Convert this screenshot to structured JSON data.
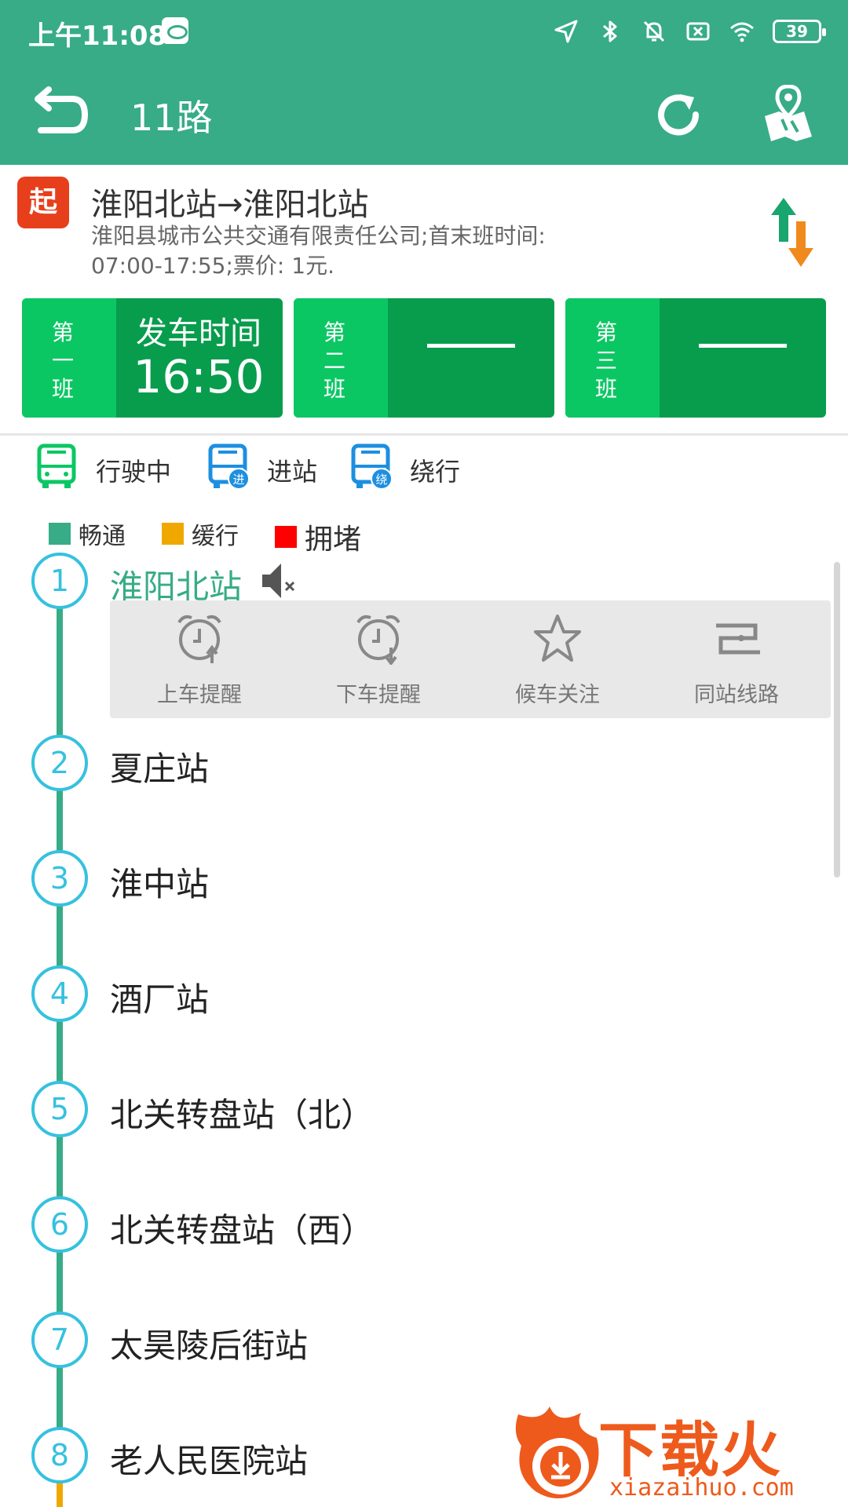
{
  "status_bar": {
    "time": "上午11:08",
    "battery": "39"
  },
  "header": {
    "title": "11路"
  },
  "route": {
    "start_badge": "起",
    "name": "淮阳北站→淮阳北站",
    "desc": "淮阳县城市公共交通有限责任公司;首末班时间: 07:00-17:55;票价: 1元."
  },
  "departures": [
    {
      "label_chars": [
        "第",
        "一",
        "班"
      ],
      "title": "发车时间",
      "time": "16:50"
    },
    {
      "label_chars": [
        "第",
        "二",
        "班"
      ]
    },
    {
      "label_chars": [
        "第",
        "三",
        "班"
      ]
    }
  ],
  "bus_legend": [
    {
      "label": "行驶中",
      "badge": ""
    },
    {
      "label": "进站",
      "badge": "进"
    },
    {
      "label": "绕行",
      "badge": "绕"
    }
  ],
  "traffic_legend": [
    {
      "label": "畅通",
      "color": "#37ac86"
    },
    {
      "label": "缓行",
      "color": "#f0a800"
    },
    {
      "label": "拥堵",
      "color": "#ff0000"
    }
  ],
  "station_actions": [
    {
      "label": "上车提醒",
      "icon": "alarm-clock-up-icon"
    },
    {
      "label": "下车提醒",
      "icon": "alarm-clock-down-icon"
    },
    {
      "label": "候车关注",
      "icon": "star-icon"
    },
    {
      "label": "同站线路",
      "icon": "route-transfer-icon"
    }
  ],
  "stations": [
    {
      "num": "1",
      "name": "淮阳北站"
    },
    {
      "num": "2",
      "name": "夏庄站"
    },
    {
      "num": "3",
      "name": "淮中站"
    },
    {
      "num": "4",
      "name": "酒厂站"
    },
    {
      "num": "5",
      "name": "北关转盘站（北）"
    },
    {
      "num": "6",
      "name": "北关转盘站（西）"
    },
    {
      "num": "7",
      "name": "太昊陵后街站"
    },
    {
      "num": "8",
      "name": "老人民医院站"
    }
  ],
  "watermark": {
    "text": "下载火",
    "url": "xiazaihuo.com"
  },
  "colors": {
    "header_green": "#37ac86",
    "station_circle": "#36c1df",
    "start_badge": "#e73f1c",
    "swap_up": "#19a56e",
    "swap_down": "#f08a1c",
    "card_light": "#0bc763",
    "card_dark": "#079d4d"
  }
}
